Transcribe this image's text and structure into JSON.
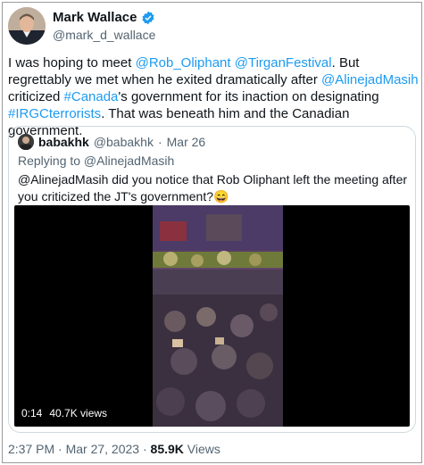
{
  "author": {
    "name": "Mark Wallace",
    "handle": "@mark_d_wallace"
  },
  "tweet": {
    "p1": "I was hoping to meet ",
    "m1": "@Rob_Oliphant",
    "s1": " ",
    "m2": "@TirganFestival",
    "p2": ". But regrettably we met when he exited dramatically after ",
    "m3": "@AlinejadMasih",
    "p3": " criticized ",
    "h1": "#Canada",
    "p4": "'s government for its inaction on designating ",
    "h2": "#IRGCterrorists",
    "p5": ". That was beneath him and the Canadian government."
  },
  "quote": {
    "name": "babakhk",
    "handle": "@babakhk",
    "dot": "·",
    "date": "Mar 26",
    "replying_to": "Replying to @AlinejadMasih",
    "text": "@AlinejadMasih did you notice that Rob Oliphant left the meeting after you criticized the JT's government?😄",
    "video_time": "0:14",
    "video_views": "40.7K views"
  },
  "footer": {
    "time": "2:37 PM · Mar 27, 2023 · ",
    "views_count": "85.9K",
    "views_label": " Views"
  },
  "colors": {
    "link": "#1d9bf0",
    "muted": "#536471",
    "text": "#0f1419"
  }
}
